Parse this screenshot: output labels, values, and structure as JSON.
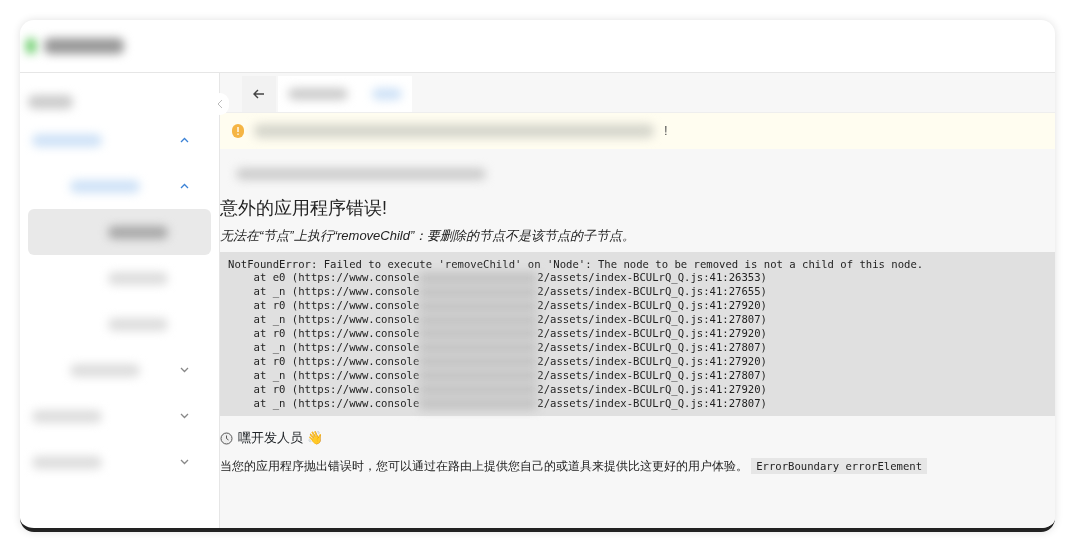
{
  "sidebar": {
    "items": [
      {
        "expanded": true,
        "children": [
          {
            "expanded": true,
            "children": [
              {
                "selected": true
              },
              {
                "selected": false
              },
              {
                "selected": false
              }
            ]
          },
          {
            "expanded": false
          }
        ]
      },
      {
        "expanded": false
      },
      {
        "expanded": false
      }
    ]
  },
  "notice": {
    "end_text": "!"
  },
  "error": {
    "title": "意外的应用程序错误!",
    "message": "无法在“节点”上执行“removeChild”：要删除的节点不是该节点的子节点。",
    "stack_head": "NotFoundError: Failed to execute 'removeChild' on 'Node': The node to be removed is not a child of this node.",
    "frames": [
      {
        "prefix": "    at e0 (https://www.console",
        "suffix": "2/assets/index-BCULrQ_Q.js:41:26353)"
      },
      {
        "prefix": "    at _n (https://www.console",
        "suffix": "2/assets/index-BCULrQ_Q.js:41:27655)"
      },
      {
        "prefix": "    at r0 (https://www.console",
        "suffix": "2/assets/index-BCULrQ_Q.js:41:27920)"
      },
      {
        "prefix": "    at _n (https://www.console",
        "suffix": "2/assets/index-BCULrQ_Q.js:41:27807)"
      },
      {
        "prefix": "    at r0 (https://www.console",
        "suffix": "2/assets/index-BCULrQ_Q.js:41:27920)"
      },
      {
        "prefix": "    at _n (https://www.console",
        "suffix": "2/assets/index-BCULrQ_Q.js:41:27807)"
      },
      {
        "prefix": "    at r0 (https://www.console",
        "suffix": "2/assets/index-BCULrQ_Q.js:41:27920)"
      },
      {
        "prefix": "    at _n (https://www.console",
        "suffix": "2/assets/index-BCULrQ_Q.js:41:27807)"
      },
      {
        "prefix": "    at r0 (https://www.console",
        "suffix": "2/assets/index-BCULrQ_Q.js:41:27920)"
      },
      {
        "prefix": "    at _n (https://www.console",
        "suffix": "2/assets/index-BCULrQ_Q.js:41:27807)"
      }
    ],
    "greeting": "嘿开发人员 👋",
    "hint": "当您的应用程序抛出错误时，您可以通过在路由上提供您自己的或道具来提供比这更好的用户体验。",
    "hint_code": "ErrorBoundary errorElement"
  }
}
